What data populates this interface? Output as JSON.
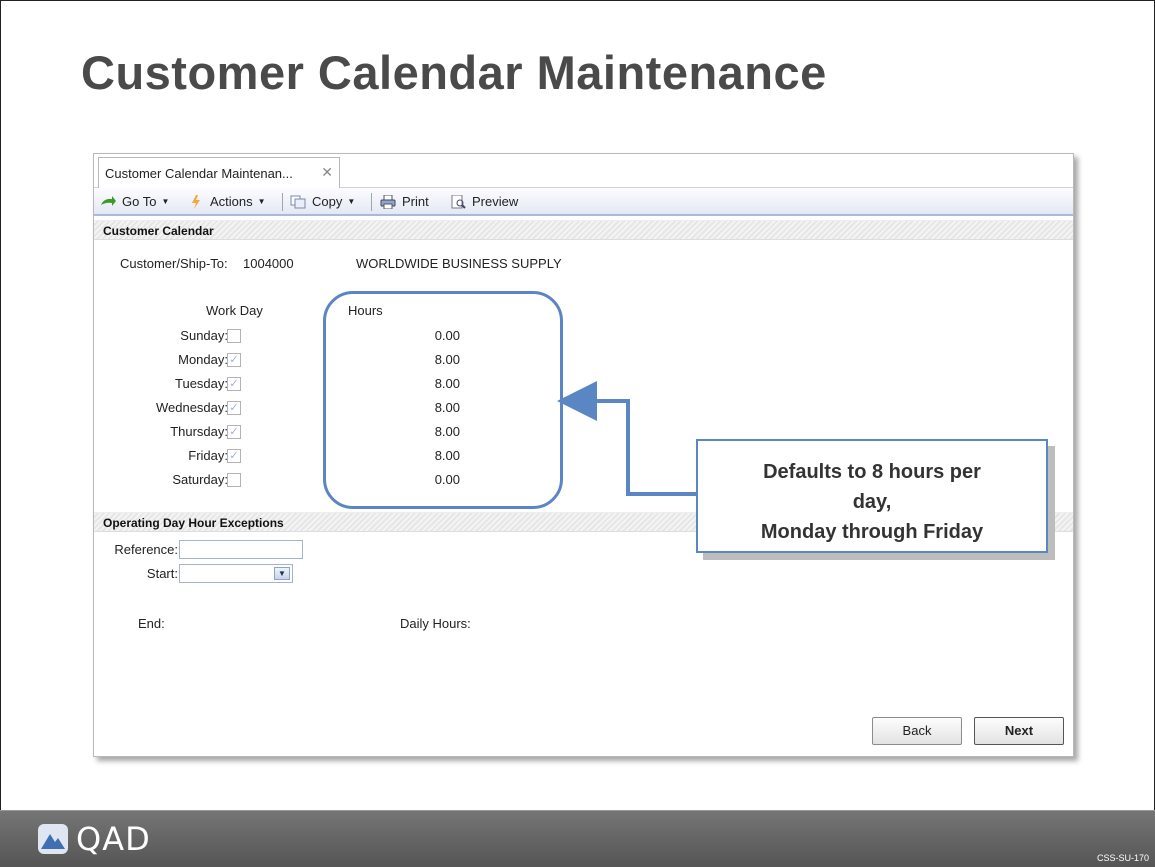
{
  "slide": {
    "title": "Customer Calendar Maintenance",
    "logo_text": "QAD",
    "code": "CSS-SU-170"
  },
  "app": {
    "tab_label": "Customer Calendar Maintenan...",
    "toolbar": {
      "goto": "Go To",
      "actions": "Actions",
      "copy": "Copy",
      "print": "Print",
      "preview": "Preview"
    },
    "customer_calendar": {
      "section_title": "Customer Calendar",
      "customer_label": "Customer/Ship-To:",
      "customer_id": "1004000",
      "customer_name": "WORLDWIDE BUSINESS SUPPLY",
      "workday_header": "Work Day",
      "hours_header": "Hours",
      "days": [
        {
          "label": "Sunday:",
          "checked": false,
          "hours": "0.00"
        },
        {
          "label": "Monday:",
          "checked": true,
          "hours": "8.00"
        },
        {
          "label": "Tuesday:",
          "checked": true,
          "hours": "8.00"
        },
        {
          "label": "Wednesday:",
          "checked": true,
          "hours": "8.00"
        },
        {
          "label": "Thursday:",
          "checked": true,
          "hours": "8.00"
        },
        {
          "label": "Friday:",
          "checked": true,
          "hours": "8.00"
        },
        {
          "label": "Saturday:",
          "checked": false,
          "hours": "0.00"
        }
      ]
    },
    "exceptions": {
      "section_title": "Operating Day Hour Exceptions",
      "reference_label": "Reference:",
      "reference_value": "",
      "start_label": "Start:",
      "start_value": "",
      "end_label": "End:",
      "daily_hours_label": "Daily Hours:"
    },
    "buttons": {
      "back": "Back",
      "next": "Next"
    }
  },
  "callout": {
    "line1": "Defaults to 8 hours per",
    "line2": "day,",
    "line3": "Monday through Friday"
  },
  "colors": {
    "accent": "#5b86c4",
    "footer": "#666666"
  }
}
